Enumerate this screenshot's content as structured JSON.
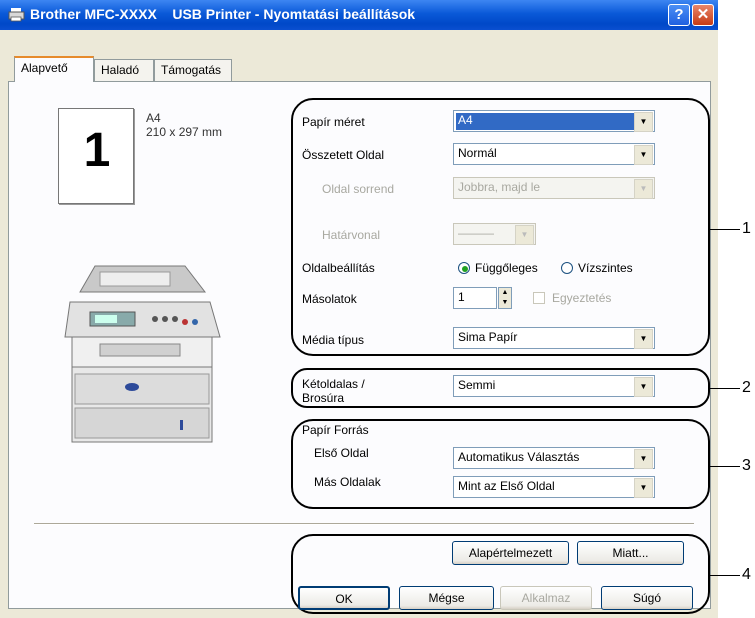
{
  "window": {
    "title": "Brother MFC-XXXX    USB Printer - Nyomtatási beállítások",
    "help_button": "?",
    "close_button": "✕"
  },
  "tabs": [
    "Alapvető",
    "Haladó",
    "Támogatás"
  ],
  "preview": {
    "page_number": "1",
    "paper": "A4",
    "dimensions": "210 x 297 mm"
  },
  "settings": {
    "paper_size": {
      "label": "Papír méret",
      "value": "A4"
    },
    "multiple_page": {
      "label": "Összetett Oldal",
      "value": "Normál"
    },
    "page_order": {
      "label": "Oldal sorrend",
      "value": "Jobbra, majd le"
    },
    "border_line": {
      "label": "Határvonal",
      "value": "———"
    },
    "orientation": {
      "label": "Oldalbeállítás",
      "portrait": "Függőleges",
      "landscape": "Vízszintes",
      "selected": "Függőleges"
    },
    "copies": {
      "label": "Másolatok",
      "value": "1",
      "collate": "Egyeztetés"
    },
    "media_type": {
      "label": "Média típus",
      "value": "Sima Papír"
    },
    "duplex": {
      "label_line1": "Kétoldalas /",
      "label_line2": "Brosúra",
      "value": "Semmi"
    },
    "paper_source": {
      "title": "Papír Forrás",
      "first_page": {
        "label": "Első Oldal",
        "value": "Automatikus Választás"
      },
      "other_pages": {
        "label": "Más Oldalak",
        "value": "Mint az Első Oldal"
      }
    }
  },
  "buttons": {
    "default": "Alapértelmezett",
    "about": "Miatt...",
    "ok": "OK",
    "cancel": "Mégse",
    "apply": "Alkalmaz",
    "help": "Súgó"
  },
  "callouts": [
    "1",
    "2",
    "3",
    "4"
  ]
}
